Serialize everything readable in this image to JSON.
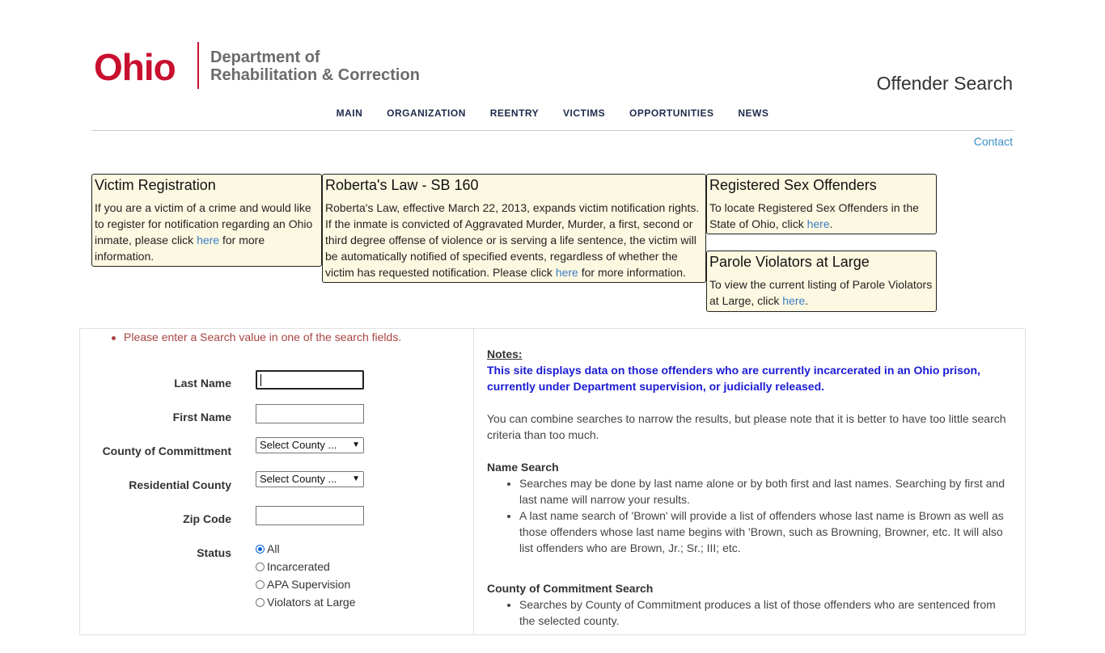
{
  "header": {
    "logo_word": "Ohio",
    "dept_line1": "Department of",
    "dept_line2": "Rehabilitation & Correction",
    "page_title": "Offender Search",
    "brand_color": "#c8102e"
  },
  "nav": {
    "items": [
      "MAIN",
      "ORGANIZATION",
      "REENTRY",
      "VICTIMS",
      "OPPORTUNITIES",
      "NEWS"
    ]
  },
  "contact_label": "Contact",
  "boxes": {
    "victim": {
      "title": "Victim Registration",
      "text_before": "If you are a victim of a crime and would like to register for notification regarding an Ohio inmate, please click ",
      "link": "here",
      "text_after": " for more information."
    },
    "roberta": {
      "title": "Roberta's Law - SB 160",
      "text_before": "Roberta's Law, effective March 22, 2013, expands victim notification rights. If the inmate is convicted of Aggravated Murder, Murder, a first, second or third degree offense of violence or is serving a life sentence, the victim will be automatically notified of specified events, regardless of whether the victim has requested notification. Please click ",
      "link": "here",
      "text_after": " for more information."
    },
    "sex_offenders": {
      "title": "Registered Sex Offenders",
      "text_before": "To locate Registered Sex Offenders in the State of Ohio, click ",
      "link": "here",
      "text_after": "."
    },
    "parole": {
      "title": "Parole Violators at Large",
      "text_before": "To view the current listing of Parole Violators at Large, click ",
      "link": "here",
      "text_after": "."
    }
  },
  "search_form": {
    "error": "Please enter a Search value in one of the search fields.",
    "last_name_label": "Last Name",
    "first_name_label": "First Name",
    "county_commitment_label": "County of Committment",
    "county_commitment_value": "Select County ...",
    "residential_county_label": "Residential County",
    "residential_county_value": "Select County ...",
    "zip_label": "Zip Code",
    "status_label": "Status",
    "status_options": [
      "All",
      "Incarcerated",
      "APA Supervision",
      "Violators at Large"
    ],
    "status_selected": "All"
  },
  "notes": {
    "title": "Notes:",
    "highlight": "This site displays data on those offenders who are currently incarcerated in an Ohio prison, currently under Department supervision, or judicially released.",
    "combine": "You can combine searches to narrow the results, but please note that it is better to have too little search criteria than too much.",
    "name_search_title": "Name Search",
    "name_search_items": [
      "Searches may be done by last name alone or by both first and last names. Searching by first and last name will narrow your results.",
      "A last name search of 'Brown' will provide a list of offenders whose last name is Brown as well as those offenders whose last name begins with 'Brown, such as Browning, Browner, etc. It will also list offenders who are Brown, Jr.; Sr.; III; etc."
    ],
    "county_search_title": "County of Commitment Search",
    "county_search_items": [
      "Searches by County of Commitment produces a list of those offenders who are sentenced from the selected county."
    ]
  }
}
